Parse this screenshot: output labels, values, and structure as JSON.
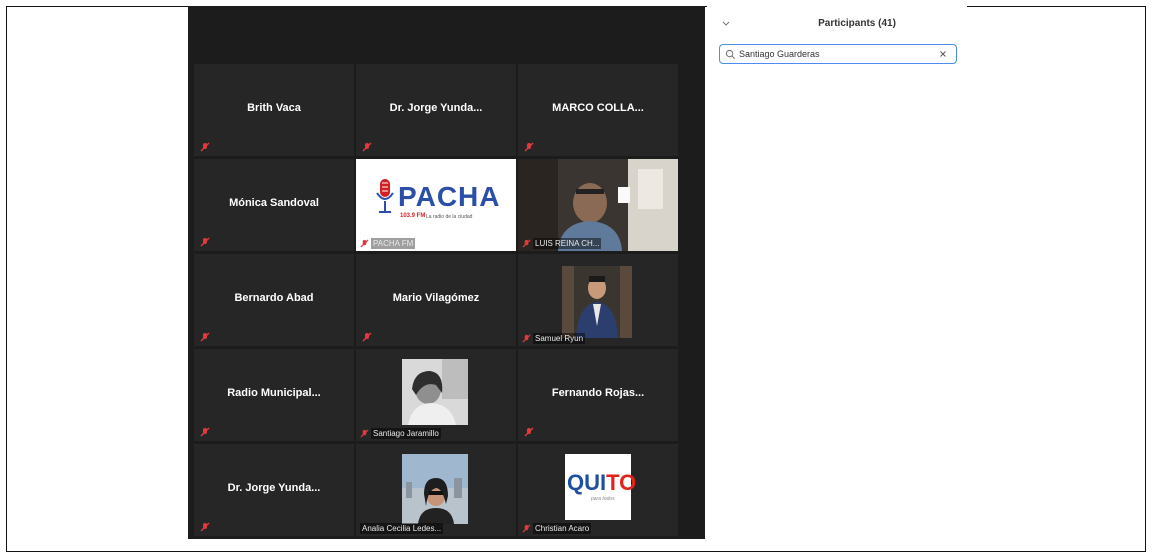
{
  "panel": {
    "title": "Participants (41)",
    "search": {
      "value": "Santiago Guarderas"
    }
  },
  "tiles": {
    "brith": {
      "name": "Brith Vaca"
    },
    "jorge1": {
      "name": "Dr. Jorge Yunda..."
    },
    "marco": {
      "name": "MARCO  COLLA..."
    },
    "monica": {
      "name": "Mónica Sandoval"
    },
    "pacha": {
      "caption": "PACHA FM",
      "logo_text": "PACHA",
      "logo_freq": "103.9 FM",
      "logo_slogan": "La radio de la ciudad"
    },
    "luis": {
      "caption": "LUIS REINA CH..."
    },
    "bernardo": {
      "name": "Bernardo Abad"
    },
    "mario": {
      "name": "Mario Vilagómez"
    },
    "samuel": {
      "caption": "Samuel Ryun"
    },
    "radio": {
      "name": "Radio  Municipal..."
    },
    "santiago": {
      "caption": "Santiago Jaramillo"
    },
    "fernando": {
      "name": "Fernando  Rojas..."
    },
    "jorge2": {
      "name": "Dr. Jorge Yunda..."
    },
    "analia": {
      "caption": "Analia Cecilia Ledes..."
    },
    "christian": {
      "caption": "Christian Acaro",
      "logo_text_a": "QUI",
      "logo_text_b": "TO",
      "logo_slogan": "para todos"
    }
  },
  "colors": {
    "tile_bg": "#262626",
    "muted_icon": "#e0393e",
    "search_border": "#4a8cf0"
  },
  "icons": [
    "mic-muted-icon",
    "search-icon",
    "clear-icon",
    "chevron-down-icon",
    "microphone-logo-icon"
  ]
}
